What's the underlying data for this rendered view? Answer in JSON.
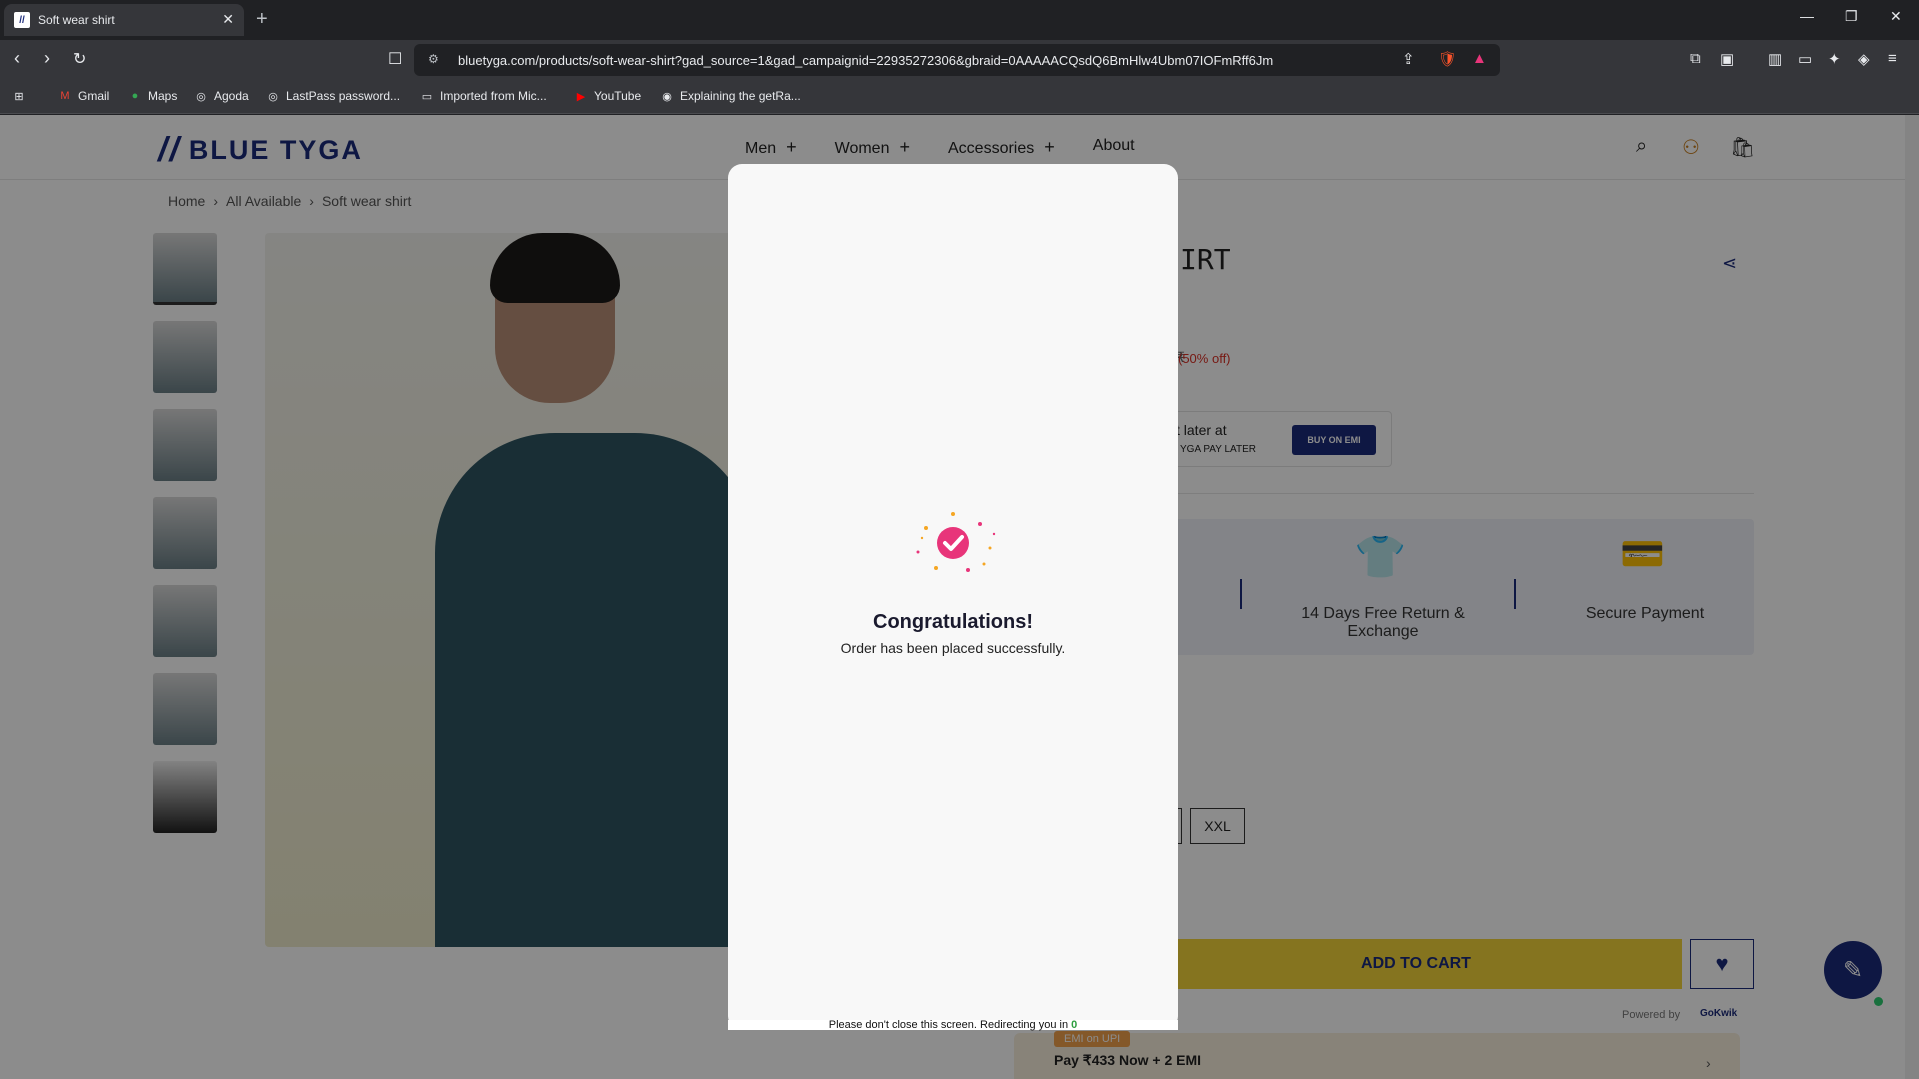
{
  "browser": {
    "tab_title": "Soft wear shirt",
    "url": "bluetyga.com/products/soft-wear-shirt?gad_source=1&gad_campaignid=22935272306&gbraid=0AAAAACQsdQ6BmHlw4Ubm07IOFmRff6Jm",
    "bookmarks": [
      "Gmail",
      "Maps",
      "Agoda",
      "LastPass password...",
      "Imported from Mic...",
      "YouTube",
      "Explaining the getRa..."
    ]
  },
  "site": {
    "brand": "BLUE TYGA",
    "nav": [
      "Men",
      "Women",
      "Accessories",
      "About"
    ],
    "breadcrumb": [
      "Home",
      "All Available",
      "Soft wear shirt"
    ]
  },
  "product": {
    "title_partial": "IRT",
    "price_strike_partial": "₹",
    "discount": "(50% off)",
    "paylater_text": "t later at",
    "paylater_sub": "YGA  PAY LATER",
    "emi_button": "BUY ON EMI",
    "features": [
      "14 Days Free Return & Exchange",
      "Secure Payment"
    ],
    "size_visible": "XXL",
    "add_to_cart": "ADD TO CART",
    "powered_by": "Powered by",
    "gokwik": "GoKwik",
    "emi_tag": "EMI on UPI",
    "emi_pay": "Pay ₹433 Now + 2 EMI"
  },
  "modal": {
    "title": "Congratulations!",
    "message": "Order has been placed successfully.",
    "footer": "Please don't close this screen. Redirecting you in",
    "countdown": "0"
  },
  "colors": {
    "brand_navy": "#1b2a7a",
    "cart_yellow": "#f3d33a",
    "success_pink": "#e8357a",
    "countdown_green": "#2e9e3f"
  }
}
